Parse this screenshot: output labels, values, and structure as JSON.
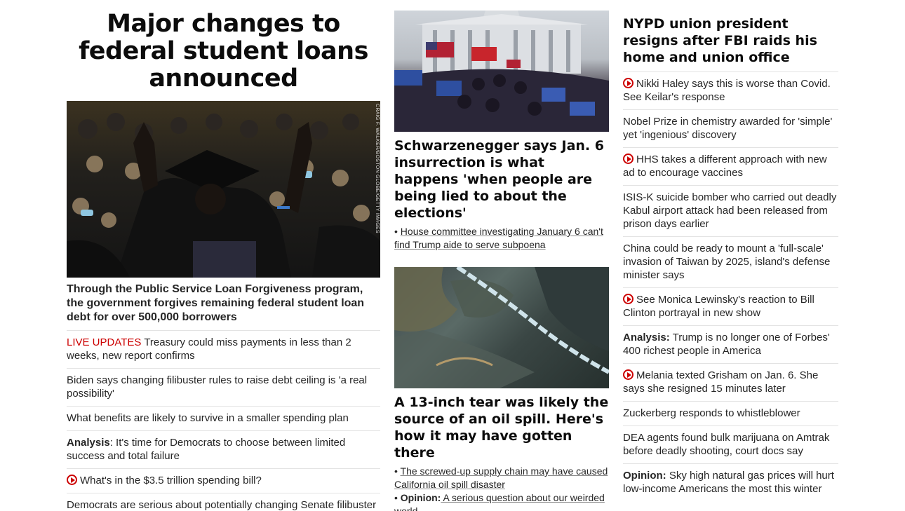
{
  "left": {
    "headline": "Major changes to federal student loans announced",
    "photo_credit": "CRAIG F. WALKER/BOSTON GLOBE/GETTY IMAGES",
    "caption": "Through the Public Service Loan Forgiveness program, the government forgives remaining federal student loan debt for over 500,000 borrowers",
    "items": [
      {
        "prefix": "LIVE UPDATES",
        "text": " Treasury could miss payments in less than 2 weeks, new report confirms"
      },
      {
        "text": "Biden says changing filibuster rules to raise debt ceiling is 'a real possibility'"
      },
      {
        "text": "What benefits are likely to survive in a smaller spending plan"
      },
      {
        "prefix": "Analysis",
        "text": ": It's time for Democrats to choose between limited success and total failure"
      },
      {
        "icon": "play-icon",
        "text": "What's in the $3.5 trillion spending bill?"
      },
      {
        "text": "Democrats are serious about potentially changing Senate filibuster rules to avoid default"
      }
    ]
  },
  "middle": {
    "story1": {
      "headline": "Schwarzenegger says Jan. 6 insurrection is what happens 'when people are being lied to about the elections'",
      "bullets": [
        {
          "text": "House committee investigating January 6 can't find Trump aide to serve subpoena"
        }
      ]
    },
    "story2": {
      "headline": "A 13-inch tear was likely the source of an oil spill. Here's how it may have gotten there",
      "bullets": [
        {
          "text": "The screwed-up supply chain may have caused California oil spill disaster"
        },
        {
          "prefix": "Opinion:",
          "text": " A serious question about our weirded world"
        }
      ]
    }
  },
  "right": {
    "headline": "NYPD union president resigns after FBI raids his home and union office",
    "items": [
      {
        "icon": "play-icon",
        "text": "Nikki Haley says this is worse than Covid. See Keilar's response"
      },
      {
        "text": "Nobel Prize in chemistry awarded for 'simple' yet 'ingenious' discovery"
      },
      {
        "icon": "play-icon",
        "text": "HHS takes a different approach with new ad to encourage vaccines"
      },
      {
        "text": "ISIS-K suicide bomber who carried out deadly Kabul airport attack had been released from prison days earlier"
      },
      {
        "text": "China could be ready to mount a 'full-scale' invasion of Taiwan by 2025, island's defense minister says"
      },
      {
        "icon": "play-icon",
        "text": "See Monica Lewinsky's reaction to Bill Clinton portrayal in new show"
      },
      {
        "prefix": "Analysis:",
        "text": " Trump is no longer one of Forbes' 400 richest people in America"
      },
      {
        "icon": "play-icon",
        "text": "Melania texted Grisham on Jan. 6. She says she resigned 15 minutes later"
      },
      {
        "text": "Zuckerberg responds to whistleblower"
      },
      {
        "text": "DEA agents found bulk marijuana on Amtrak before deadly shooting, court docs say"
      },
      {
        "prefix": "Opinion:",
        "text": " Sky high natural gas prices will hurt low-income Americans the most this winter"
      }
    ]
  },
  "colors": {
    "accent_red": "#cc0000",
    "text": "#262626",
    "divider": "#e3e3e3"
  }
}
